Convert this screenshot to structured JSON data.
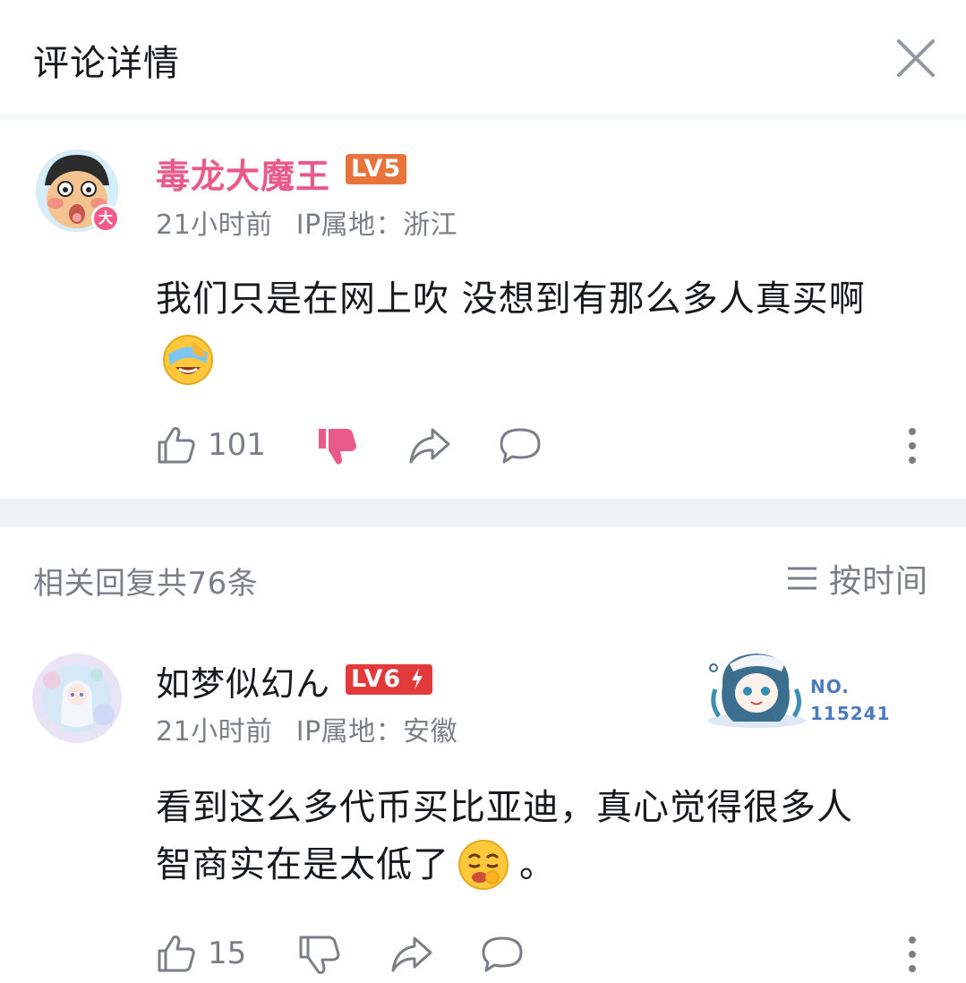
{
  "header": {
    "title": "评论详情"
  },
  "main_comment": {
    "username": "毒龙大魔王",
    "level": "LV5",
    "avatar_badge": "大",
    "time": "21小时前",
    "ip": "IP属地：浙江",
    "text": "我们只是在网上吹 没想到有那么多人真买啊",
    "likes": "101",
    "colors": {
      "username": "#e95a8b",
      "level_badge": "#e8743b",
      "dislike_active": "#e95a8b"
    }
  },
  "replies_header": {
    "count_label": "相关回复共76条",
    "sort_label": "按时间"
  },
  "reply": {
    "username": "如梦似幻ん",
    "level": "LV6",
    "time": "21小时前",
    "ip": "IP属地：安徽",
    "text_line1": "看到这么多代币买比亚迪，真心觉得很多人",
    "text_line2": "智商实在是太低了",
    "text_end": "。",
    "likes": "15",
    "fan_badge_no_label": "NO.",
    "fan_badge_number": "115241",
    "colors": {
      "level_badge": "#e23a3a"
    }
  },
  "icons": [
    "close-icon",
    "thumb-up-icon",
    "thumb-down-icon",
    "share-icon",
    "comment-icon",
    "more-vertical-icon",
    "sort-icon",
    "emoji-laugh-cover-icon",
    "emoji-smirk-icon"
  ]
}
